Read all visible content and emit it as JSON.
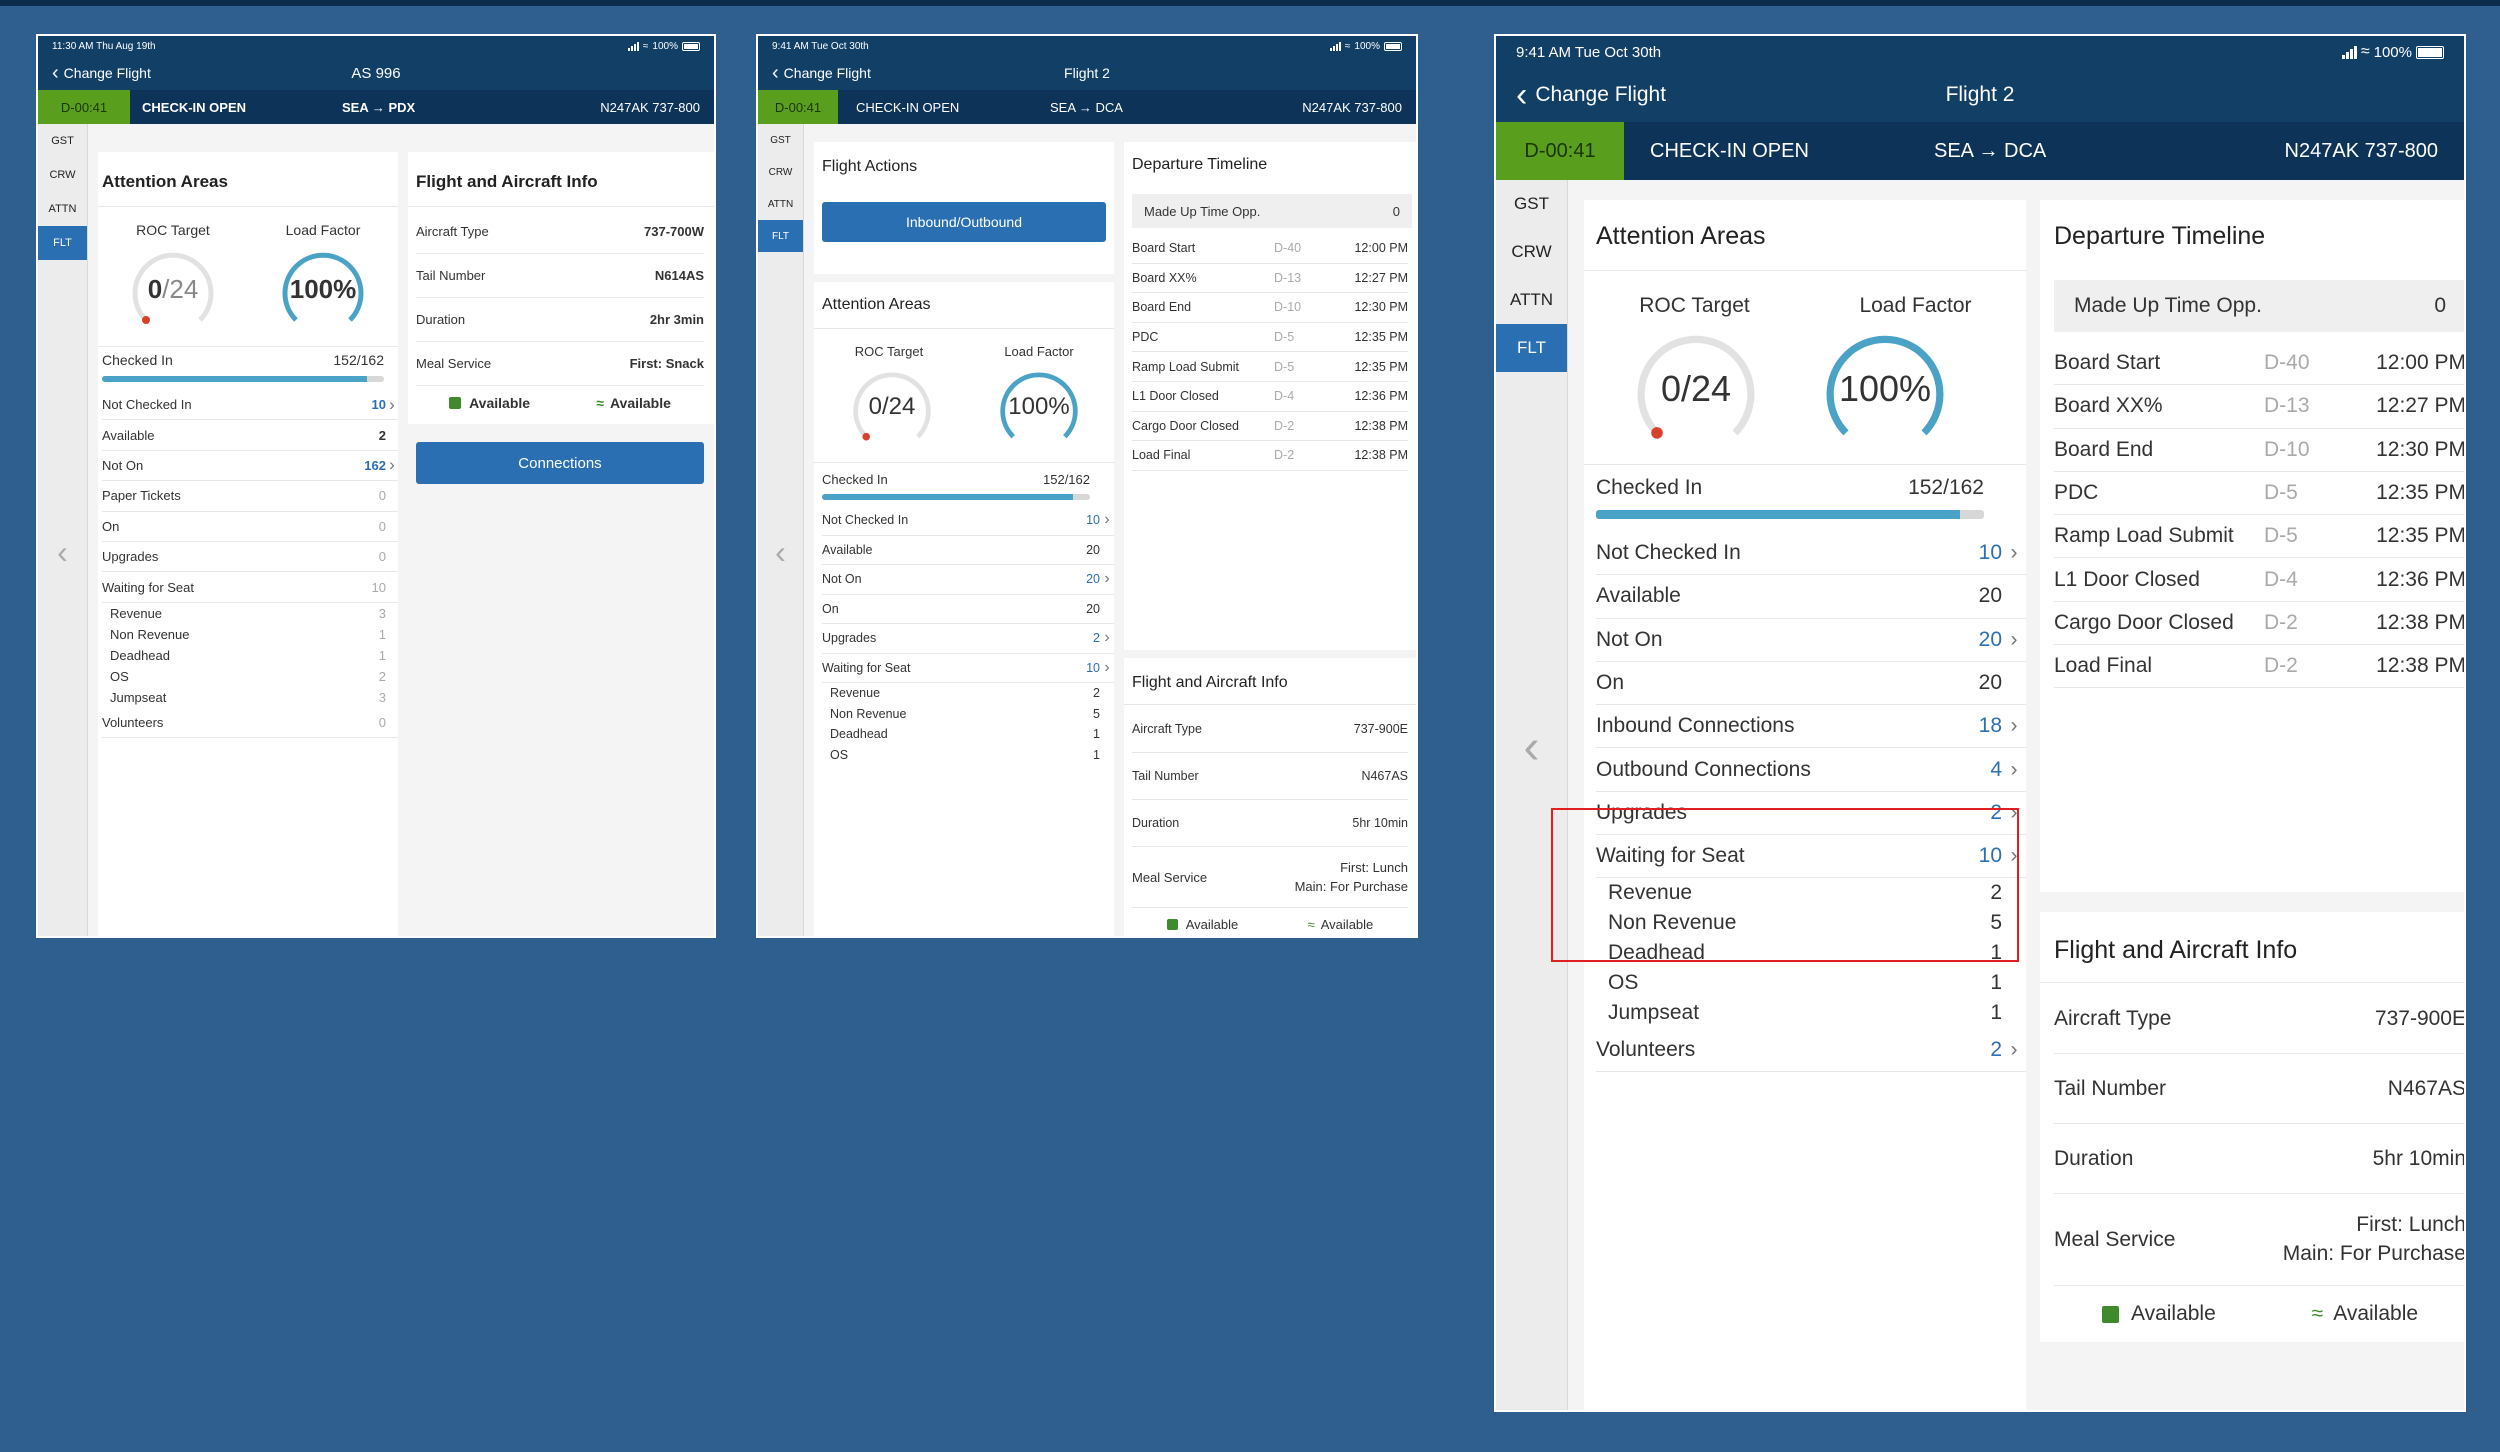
{
  "screen1": {
    "status": {
      "time": "11:30 AM  Thu Aug 19th",
      "battery": "100%"
    },
    "nav": {
      "back_label": "Change Flight",
      "title": "AS 996"
    },
    "flight_bar": {
      "timer": "D-00:41",
      "status": "CHECK-IN OPEN",
      "route": "SEA → PDX",
      "aircraft": "N247AK  737-800"
    },
    "side_tabs": [
      "GST",
      "CRW",
      "ATTN",
      "FLT"
    ],
    "attention": {
      "title": "Attention Areas",
      "roc_label": "ROC Target",
      "roc_value": "0",
      "roc_total": "/24",
      "load_label": "Load Factor",
      "load_value": "100%",
      "checked_in_label": "Checked In",
      "checked_in_value": "152/162",
      "checked_in_progress": 0.938,
      "rows": [
        {
          "label": "Not Checked In",
          "value": "10"
        },
        {
          "label": "Available",
          "value": "2"
        },
        {
          "label": "Not On",
          "value": "162"
        },
        {
          "label": "Paper Tickets",
          "value": "0"
        },
        {
          "label": "On",
          "value": "0"
        },
        {
          "label": "Upgrades",
          "value": "0"
        },
        {
          "label": "Waiting for Seat",
          "value": "10"
        },
        {
          "label": "Revenue",
          "value": "3"
        },
        {
          "label": "Non Revenue",
          "value": "1"
        },
        {
          "label": "Deadhead",
          "value": "1"
        },
        {
          "label": "OS",
          "value": "2"
        },
        {
          "label": "Jumpseat",
          "value": "3"
        },
        {
          "label": "Volunteers",
          "value": "0"
        }
      ]
    },
    "info": {
      "title": "Flight and Aircraft Info",
      "rows": [
        {
          "label": "Aircraft Type",
          "value": "737-700W"
        },
        {
          "label": "Tail Number",
          "value": "N614AS"
        },
        {
          "label": "Duration",
          "value": "2hr 3min"
        },
        {
          "label": "Meal Service",
          "value": "First: Snack"
        }
      ],
      "power": "Available",
      "wifi": "Available",
      "connections_button": "Connections"
    }
  },
  "screen2": {
    "status": {
      "time": "9:41 AM   Tue Oct 30th",
      "battery": "100%"
    },
    "nav": {
      "back_label": "Change Flight",
      "title": "Flight 2"
    },
    "flight_bar": {
      "timer": "D-00:41",
      "status": "CHECK-IN OPEN",
      "route": "SEA → DCA",
      "aircraft": "N247AK  737-800"
    },
    "side_tabs": [
      "GST",
      "CRW",
      "ATTN",
      "FLT"
    ],
    "actions": {
      "title": "Flight Actions",
      "button": "Inbound/Outbound"
    },
    "attention": {
      "title": "Attention Areas",
      "roc_label": "ROC Target",
      "roc_value": "0",
      "roc_total": "/24",
      "load_label": "Load Factor",
      "load_value": "100%",
      "checked_in_label": "Checked In",
      "checked_in_value": "152/162",
      "checked_in_progress": 0.938,
      "rows": [
        {
          "label": "Not Checked In",
          "value": "10"
        },
        {
          "label": "Available",
          "value": "20"
        },
        {
          "label": "Not On",
          "value": "20"
        },
        {
          "label": "On",
          "value": "20"
        },
        {
          "label": "Upgrades",
          "value": "2"
        },
        {
          "label": "Waiting for Seat",
          "value": "10"
        },
        {
          "label": "Revenue",
          "value": "2"
        },
        {
          "label": "Non Revenue",
          "value": "5"
        },
        {
          "label": "Deadhead",
          "value": "1"
        },
        {
          "label": "OS",
          "value": "1"
        }
      ]
    },
    "timeline": {
      "title": "Departure Timeline",
      "made_up_label": "Made Up Time Opp.",
      "made_up_value": "0",
      "rows": [
        {
          "label": "Board Start",
          "d": "D-40",
          "time": "12:00 PM"
        },
        {
          "label": "Board XX%",
          "d": "D-13",
          "time": "12:27 PM"
        },
        {
          "label": "Board End",
          "d": "D-10",
          "time": "12:30 PM"
        },
        {
          "label": "PDC",
          "d": "D-5",
          "time": "12:35 PM"
        },
        {
          "label": "Ramp Load Submit",
          "d": "D-5",
          "time": "12:35 PM"
        },
        {
          "label": "L1 Door Closed",
          "d": "D-4",
          "time": "12:36 PM"
        },
        {
          "label": "Cargo Door Closed",
          "d": "D-2",
          "time": "12:38 PM"
        },
        {
          "label": "Load Final",
          "d": "D-2",
          "time": "12:38 PM"
        }
      ]
    },
    "info": {
      "title": "Flight and Aircraft Info",
      "rows": [
        {
          "label": "Aircraft Type",
          "value": "737-900E"
        },
        {
          "label": "Tail Number",
          "value": "N467AS"
        },
        {
          "label": "Duration",
          "value": "5hr 10min"
        }
      ],
      "meal_label": "Meal Service",
      "meal_line1": "First: Lunch",
      "meal_line2": "Main: For Purchase",
      "power": "Available",
      "wifi": "Available"
    }
  },
  "screen3": {
    "status": {
      "time": "9:41 AM   Tue Oct 30th",
      "battery": "100%"
    },
    "nav": {
      "back_label": "Change Flight",
      "title": "Flight 2"
    },
    "flight_bar": {
      "timer": "D-00:41",
      "status": "CHECK-IN OPEN",
      "route": "SEA → DCA",
      "aircraft": "N247AK  737-800"
    },
    "side_tabs": [
      "GST",
      "CRW",
      "ATTN",
      "FLT"
    ],
    "attention": {
      "title": "Attention Areas",
      "roc_label": "ROC Target",
      "roc_value": "0",
      "roc_total": "/24",
      "load_label": "Load Factor",
      "load_value": "100%",
      "checked_in_label": "Checked In",
      "checked_in_value": "152/162",
      "checked_in_progress": 0.938,
      "rows": [
        {
          "label": "Not Checked In",
          "value": "10"
        },
        {
          "label": "Available",
          "value": "20"
        },
        {
          "label": "Not On",
          "value": "20"
        },
        {
          "label": "On",
          "value": "20"
        },
        {
          "label": "Inbound Connections",
          "value": "18"
        },
        {
          "label": "Outbound Connections",
          "value": "4"
        },
        {
          "label": "Upgrades",
          "value": "2"
        },
        {
          "label": "Waiting for Seat",
          "value": "10"
        },
        {
          "label": "Revenue",
          "value": "2"
        },
        {
          "label": "Non Revenue",
          "value": "5"
        },
        {
          "label": "Deadhead",
          "value": "1"
        },
        {
          "label": "OS",
          "value": "1"
        },
        {
          "label": "Jumpseat",
          "value": "1"
        },
        {
          "label": "Volunteers",
          "value": "2"
        }
      ]
    },
    "timeline": {
      "title": "Departure Timeline",
      "made_up_label": "Made Up Time Opp.",
      "made_up_value": "0",
      "rows": [
        {
          "label": "Board Start",
          "d": "D-40",
          "time": "12:00 PM"
        },
        {
          "label": "Board XX%",
          "d": "D-13",
          "time": "12:27 PM"
        },
        {
          "label": "Board End",
          "d": "D-10",
          "time": "12:30 PM"
        },
        {
          "label": "PDC",
          "d": "D-5",
          "time": "12:35 PM"
        },
        {
          "label": "Ramp Load Submit",
          "d": "D-5",
          "time": "12:35 PM"
        },
        {
          "label": "L1 Door Closed",
          "d": "D-4",
          "time": "12:36 PM"
        },
        {
          "label": "Cargo Door Closed",
          "d": "D-2",
          "time": "12:38 PM"
        },
        {
          "label": "Load Final",
          "d": "D-2",
          "time": "12:38 PM"
        }
      ]
    },
    "info": {
      "title": "Flight and Aircraft Info",
      "rows": [
        {
          "label": "Aircraft Type",
          "value": "737-900E"
        },
        {
          "label": "Tail Number",
          "value": "N467AS"
        },
        {
          "label": "Duration",
          "value": "5hr 10min"
        }
      ],
      "meal_label": "Meal Service",
      "meal_line1": "First: Lunch",
      "meal_line2": "Main: For Purchase",
      "power": "Available",
      "wifi": "Available"
    }
  },
  "colors": {
    "background": "#2f5f8e",
    "header": "#123f66",
    "timer_green": "#5a9e1e",
    "accent_blue": "#2b6fb3",
    "gauge_teal": "#4aa3c7",
    "highlight_red": "#e02020"
  }
}
